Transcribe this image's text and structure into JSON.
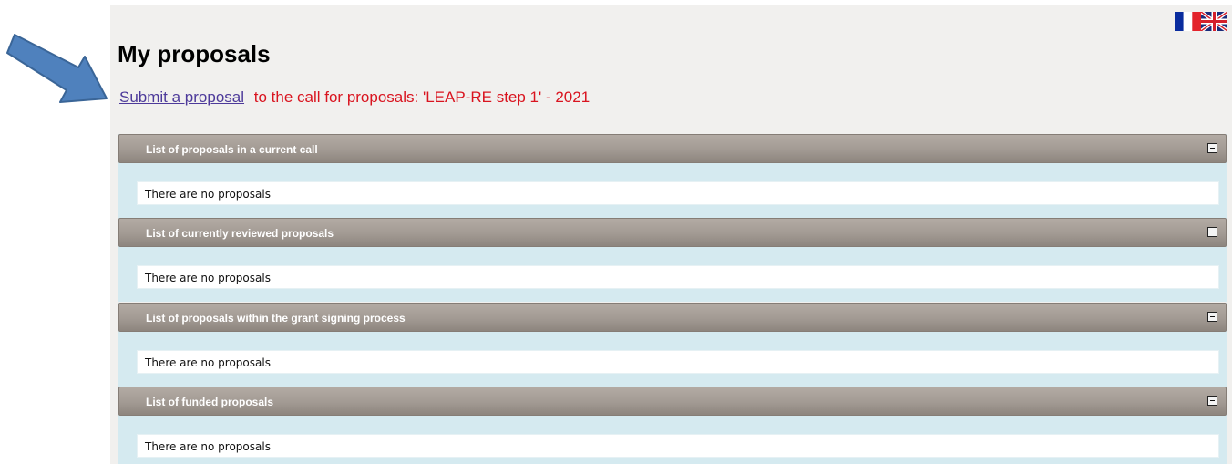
{
  "page_title": "My proposals",
  "submit": {
    "link_label": "Submit a proposal",
    "call_text": "to the call for proposals: 'LEAP-RE step 1' - 2021"
  },
  "languages": [
    {
      "name": "french-flag"
    },
    {
      "name": "uk-flag"
    }
  ],
  "panels": [
    {
      "title": "List of proposals in a current call",
      "empty_text": "There are no proposals"
    },
    {
      "title": "List of currently reviewed proposals",
      "empty_text": "There are no proposals"
    },
    {
      "title": "List of proposals within the grant signing process",
      "empty_text": "There are no proposals"
    },
    {
      "title": "List of funded proposals",
      "empty_text": "There are no proposals"
    }
  ],
  "colors": {
    "arrow": "#4f81bd",
    "link": "#4d3a9a",
    "call_text": "#d9141f",
    "panel_header": "#a29a93",
    "panel_body": "#d5eaf0"
  }
}
